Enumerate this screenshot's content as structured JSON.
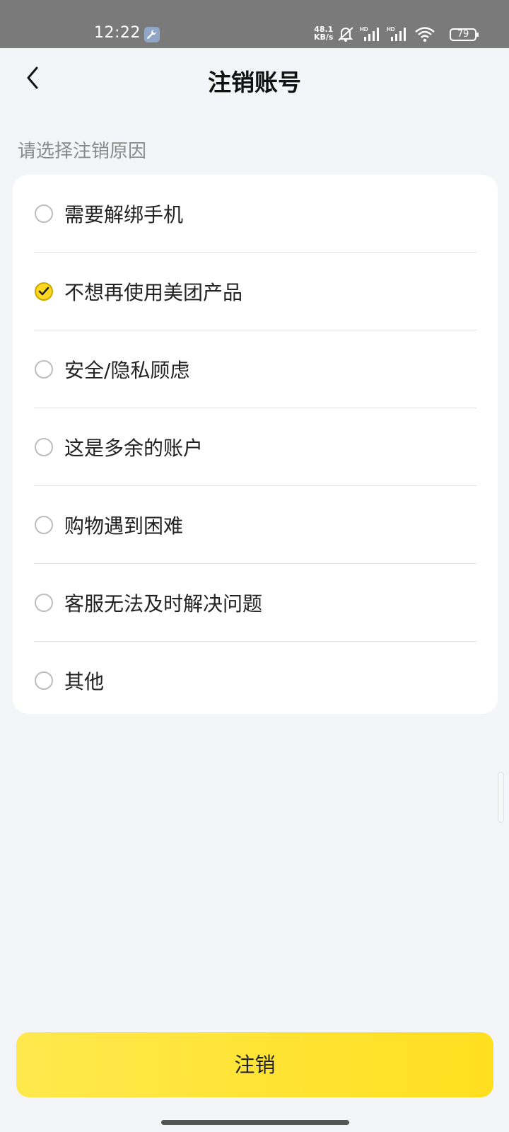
{
  "status_bar": {
    "time": "12:22",
    "net_speed_value": "48.1",
    "net_speed_unit": "KB/s",
    "signal1_label": "HD",
    "signal2_label": "HD",
    "battery": "79",
    "icons": [
      "wrench-icon",
      "mute-icon",
      "signal-icon",
      "signal-icon",
      "wifi-icon",
      "battery-icon"
    ]
  },
  "header": {
    "title": "注销账号",
    "back_icon": "chevron-left-icon"
  },
  "section_label": "请选择注销原因",
  "reasons": [
    {
      "label": "需要解绑手机",
      "selected": false
    },
    {
      "label": "不想再使用美团产品",
      "selected": true
    },
    {
      "label": "安全/隐私顾虑",
      "selected": false
    },
    {
      "label": "这是多余的账户",
      "selected": false
    },
    {
      "label": "购物遇到困难",
      "selected": false
    },
    {
      "label": "客服无法及时解决问题",
      "selected": false
    },
    {
      "label": "其他",
      "selected": false
    }
  ],
  "footer": {
    "cancel_label": "注销"
  },
  "colors": {
    "accent": "#ffdf1f",
    "background": "#f4f5f9",
    "status_bar": "#7a7a7a"
  }
}
